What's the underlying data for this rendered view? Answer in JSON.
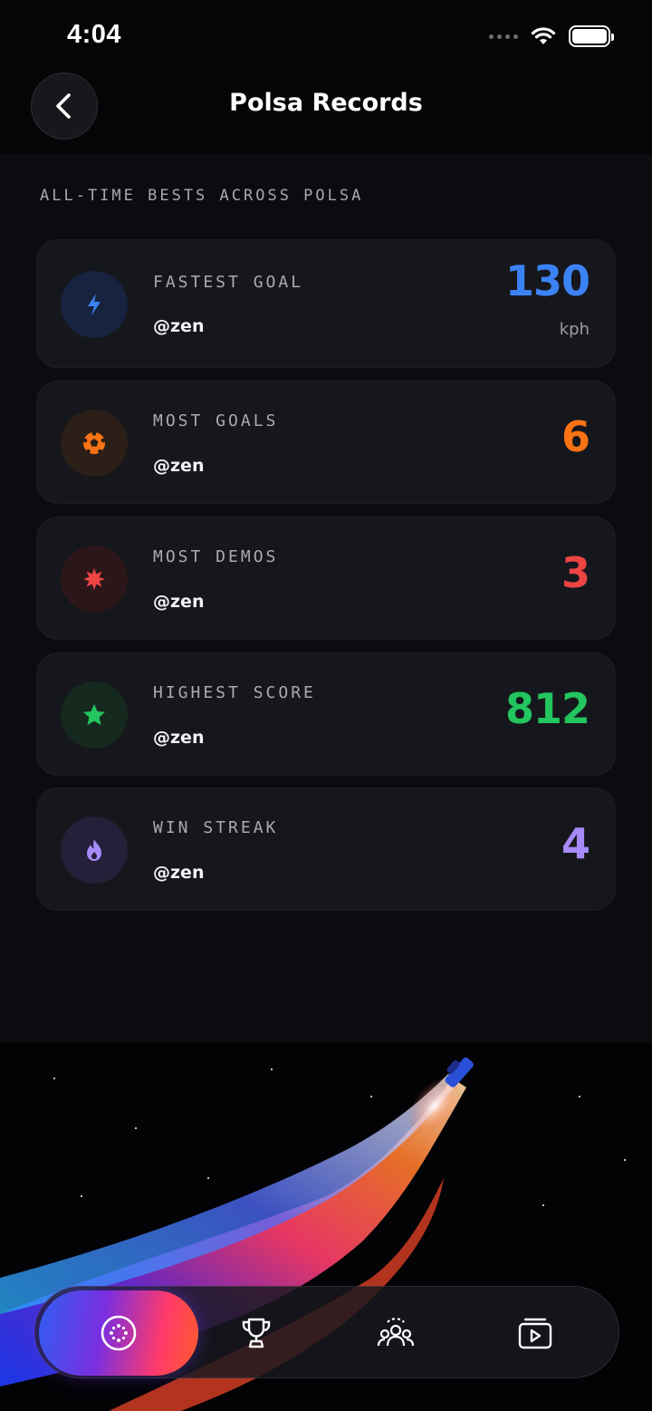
{
  "status_bar": {
    "time": "4:04"
  },
  "header": {
    "title": "Polsa Records",
    "back_icon": "chevron-left-icon"
  },
  "section": {
    "label": "ALL-TIME BESTS ACROSS POLSA"
  },
  "records": [
    {
      "label": "FASTEST GOAL",
      "user": "@zen",
      "value": "130",
      "unit": "kph",
      "color": "#3b82f6",
      "icon": "lightning-icon"
    },
    {
      "label": "MOST GOALS",
      "user": "@zen",
      "value": "6",
      "color": "#f97316",
      "icon": "soccer-ball-icon"
    },
    {
      "label": "MOST DEMOS",
      "user": "@zen",
      "value": "3",
      "color": "#ef4444",
      "icon": "explosion-icon"
    },
    {
      "label": "HIGHEST SCORE",
      "user": "@zen",
      "value": "812",
      "color": "#22c55e",
      "icon": "star-icon"
    },
    {
      "label": "WIN STREAK",
      "user": "@zen",
      "value": "4",
      "color": "#a78bfa",
      "icon": "flame-icon"
    }
  ],
  "tab_bar": {
    "tabs": [
      {
        "icon": "ball-icon",
        "active": true
      },
      {
        "icon": "trophy-icon",
        "active": false
      },
      {
        "icon": "community-icon",
        "active": false
      },
      {
        "icon": "replay-icon",
        "active": false
      }
    ]
  }
}
